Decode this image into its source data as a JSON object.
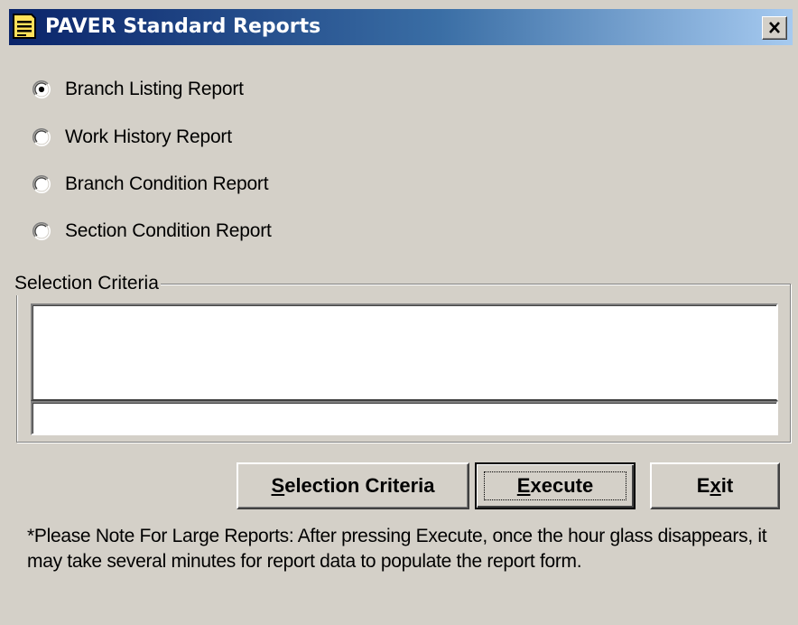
{
  "window": {
    "title": "PAVER Standard Reports",
    "close_label": "×",
    "colors": {
      "face": "#d4d0c8",
      "title_start": "#0a246a",
      "title_end": "#a6caf0",
      "field": "#ffffff"
    },
    "icons": [
      "report-icon",
      "close-icon",
      "radio-icon"
    ]
  },
  "report_options": [
    {
      "label": "Branch Listing Report",
      "selected": true
    },
    {
      "label": "Work History Report",
      "selected": false
    },
    {
      "label": "Branch Condition Report",
      "selected": false
    },
    {
      "label": "Section Condition Report",
      "selected": false
    }
  ],
  "criteria": {
    "legend": "Selection Criteria",
    "text_value": "",
    "line_value": ""
  },
  "buttons": {
    "selection_pre": "",
    "selection_key": "S",
    "selection_rest": "election Criteria",
    "execute_pre": "",
    "execute_key": "E",
    "execute_rest": "xecute",
    "exit_pre": "E",
    "exit_key": "x",
    "exit_rest": "it"
  },
  "note": "*Please Note For Large Reports:  After pressing Execute, once the hour glass disappears, it may take several minutes for report data to populate the report form."
}
